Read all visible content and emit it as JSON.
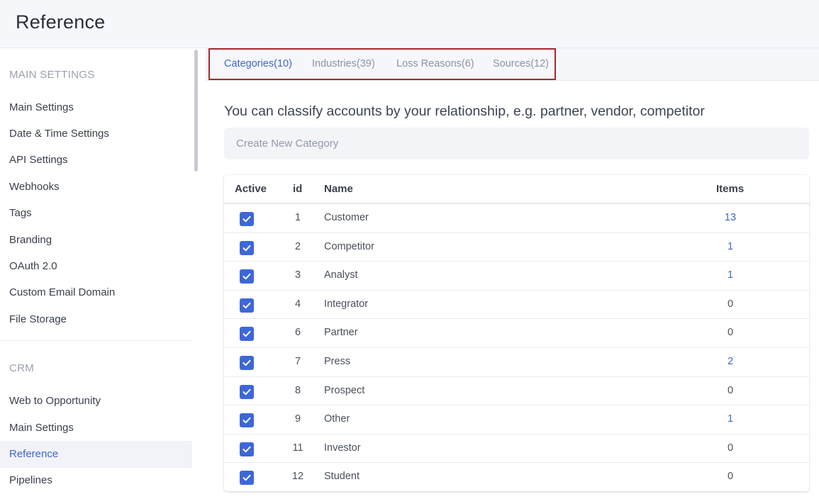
{
  "header": {
    "title": "Reference"
  },
  "sidebar": {
    "sections": [
      {
        "title": "MAIN SETTINGS",
        "items": [
          "Main Settings",
          "Date & Time Settings",
          "API Settings",
          "Webhooks",
          "Tags",
          "Branding",
          "OAuth 2.0",
          "Custom Email Domain",
          "File Storage"
        ]
      },
      {
        "title": "CRM",
        "items": [
          "Web to Opportunity",
          "Main Settings",
          "Reference",
          "Pipelines"
        ]
      }
    ],
    "active_item": "Reference"
  },
  "tabs": [
    {
      "label": "Categories(10)",
      "active": true
    },
    {
      "label": "Industries(39)",
      "active": false
    },
    {
      "label": "Loss Reasons(6)",
      "active": false
    },
    {
      "label": "Sources(12)",
      "active": false
    }
  ],
  "main": {
    "description": "You can classify accounts by your relationship, e.g. partner, vendor, competitor",
    "create_placeholder": "Create New Category"
  },
  "table": {
    "headers": {
      "active": "Active",
      "id": "id",
      "name": "Name",
      "items": "Items"
    },
    "rows": [
      {
        "active": true,
        "id": "1",
        "name": "Customer",
        "items": "13",
        "items_link": true
      },
      {
        "active": true,
        "id": "2",
        "name": "Competitor",
        "items": "1",
        "items_link": true
      },
      {
        "active": true,
        "id": "3",
        "name": "Analyst",
        "items": "1",
        "items_link": true
      },
      {
        "active": true,
        "id": "4",
        "name": "Integrator",
        "items": "0",
        "items_link": false
      },
      {
        "active": true,
        "id": "6",
        "name": "Partner",
        "items": "0",
        "items_link": false
      },
      {
        "active": true,
        "id": "7",
        "name": "Press",
        "items": "2",
        "items_link": true
      },
      {
        "active": true,
        "id": "8",
        "name": "Prospect",
        "items": "0",
        "items_link": false
      },
      {
        "active": true,
        "id": "9",
        "name": "Other",
        "items": "1",
        "items_link": true
      },
      {
        "active": true,
        "id": "11",
        "name": "Investor",
        "items": "0",
        "items_link": false
      },
      {
        "active": true,
        "id": "12",
        "name": "Student",
        "items": "0",
        "items_link": false
      }
    ]
  },
  "colors": {
    "accent": "#4166c8",
    "checkbox": "#3d67d8",
    "highlight_border": "#a8292b"
  }
}
